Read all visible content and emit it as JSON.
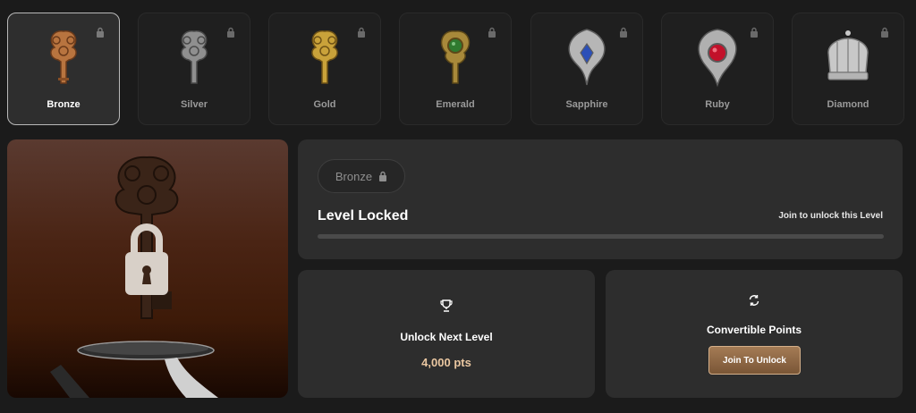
{
  "tiers": [
    {
      "label": "Bronze",
      "active": true,
      "color": "#b8743f",
      "accent": "#6b3a1a"
    },
    {
      "label": "Silver",
      "active": false,
      "color": "#8f8f8f",
      "accent": "#4a4a4a"
    },
    {
      "label": "Gold",
      "active": false,
      "color": "#c9a23a",
      "accent": "#6e5216"
    },
    {
      "label": "Emerald",
      "active": false,
      "color": "#a8893a",
      "accent": "#2f7a2f"
    },
    {
      "label": "Sapphire",
      "active": false,
      "color": "#b6b6b6",
      "accent": "#2b4fb8"
    },
    {
      "label": "Ruby",
      "active": false,
      "color": "#b0b0b0",
      "accent": "#c2112a"
    },
    {
      "label": "Diamond",
      "active": false,
      "color": "#c8c8c8",
      "accent": "#8a8a8a"
    }
  ],
  "status": {
    "pill_label": "Bronze",
    "title": "Level Locked",
    "hint": "Join to unlock this Level",
    "progress": 0
  },
  "unlock_card": {
    "icon": "trophy-icon",
    "title": "Unlock Next Level",
    "points": "4,000 pts"
  },
  "points_card": {
    "icon": "refresh-icon",
    "title": "Convertible Points",
    "button_label": "Join To Unlock"
  },
  "colors": {
    "background": "#1b1b1b",
    "panel": "#2d2d2d",
    "accent": "#c49a6c",
    "points_text": "#eac7a1"
  }
}
